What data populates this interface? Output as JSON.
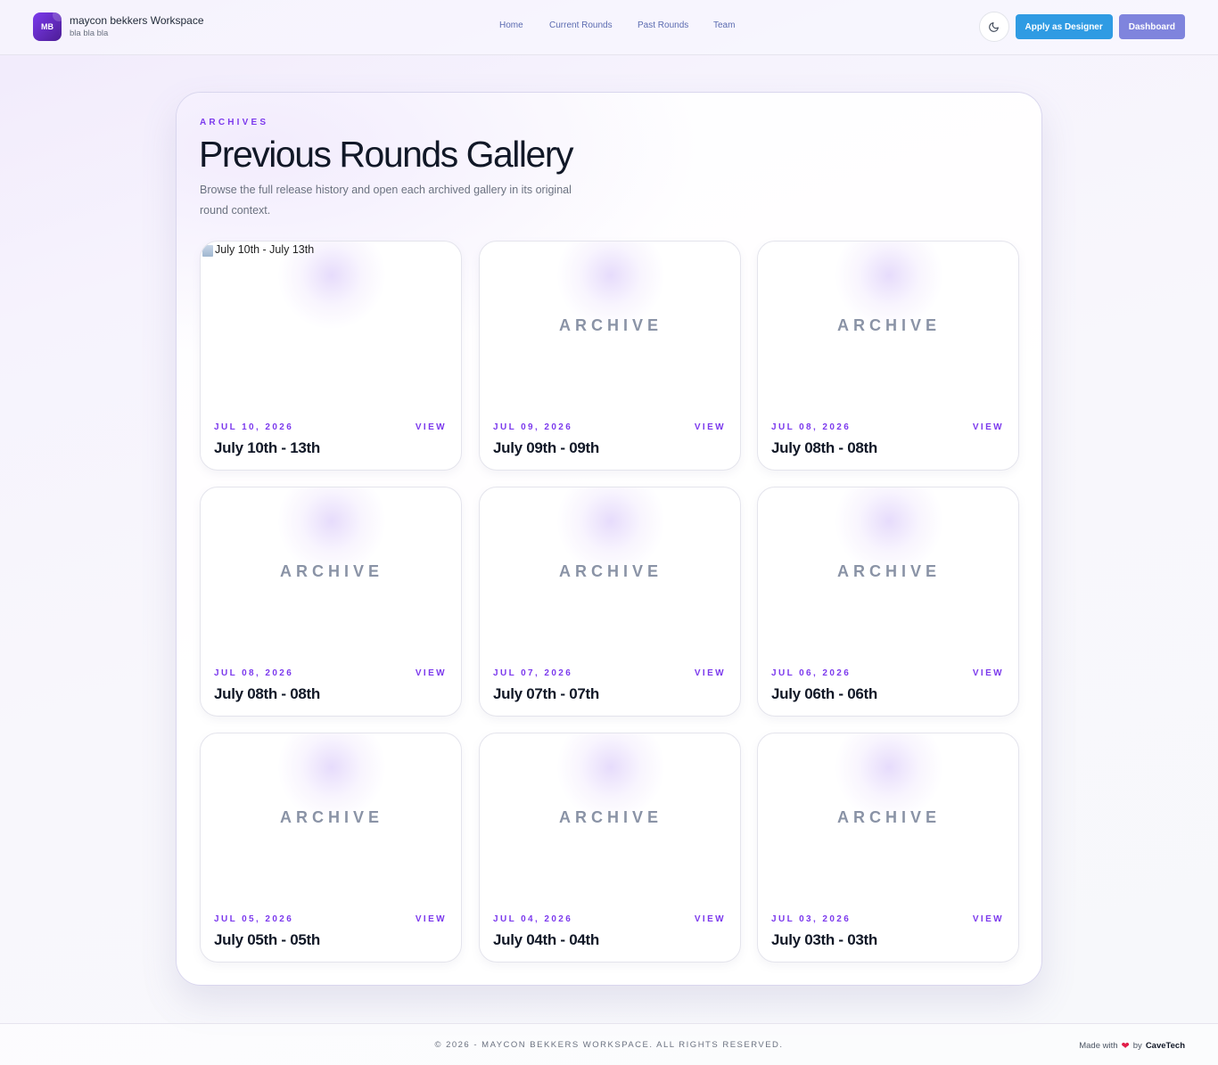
{
  "header": {
    "logo_initials": "MB",
    "brand_name": "maycon bekkers Workspace",
    "brand_subtitle": "bla bla bla",
    "nav": [
      {
        "label": "Home"
      },
      {
        "label": "Current Rounds"
      },
      {
        "label": "Past Rounds"
      },
      {
        "label": "Team"
      }
    ],
    "theme_toggle_icon": "moon-icon",
    "apply_label": "Apply as Designer",
    "dashboard_label": "Dashboard",
    "colors": {
      "apply": "#2f9be3",
      "dashboard": "#7f84dd",
      "accent": "#7c3aed"
    }
  },
  "archive": {
    "eyebrow": "ARCHIVES",
    "title": "Previous Rounds Gallery",
    "description": "Browse the full release history and open each archived gallery in its original round context.",
    "placeholder_label": "ARCHIVE",
    "view_label": "VIEW",
    "cards": [
      {
        "date": "JUL 10, 2026",
        "title": "July 10th - 13th",
        "image_alt": "July 10th - July 13th",
        "has_broken_image": true
      },
      {
        "date": "JUL 09, 2026",
        "title": "July 09th - 09th"
      },
      {
        "date": "JUL 08, 2026",
        "title": "July 08th - 08th"
      },
      {
        "date": "JUL 08, 2026",
        "title": "July 08th - 08th"
      },
      {
        "date": "JUL 07, 2026",
        "title": "July 07th - 07th"
      },
      {
        "date": "JUL 06, 2026",
        "title": "July 06th - 06th"
      },
      {
        "date": "JUL 05, 2026",
        "title": "July 05th - 05th"
      },
      {
        "date": "JUL 04, 2026",
        "title": "July 04th - 04th"
      },
      {
        "date": "JUL 03, 2026",
        "title": "July 03th - 03th"
      }
    ]
  },
  "footer": {
    "copyright": "© 2026 - MAYCON BEKKERS WORKSPACE. ALL RIGHTS RESERVED.",
    "made_with": "Made with",
    "heart_icon": "heart-icon",
    "by": "by",
    "credit_brand": "CaveTech"
  }
}
